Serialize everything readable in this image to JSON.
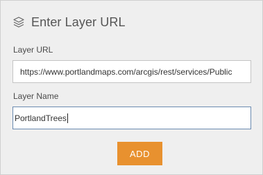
{
  "header": {
    "icon": "layers-icon",
    "title": "Enter Layer URL"
  },
  "layer_url": {
    "label": "Layer URL",
    "value": "https://www.portlandmaps.com/arcgis/rest/services/Public"
  },
  "layer_name": {
    "label": "Layer Name",
    "value": "PortlandTrees"
  },
  "add_button": {
    "label": "ADD",
    "color": "#e8912f"
  }
}
